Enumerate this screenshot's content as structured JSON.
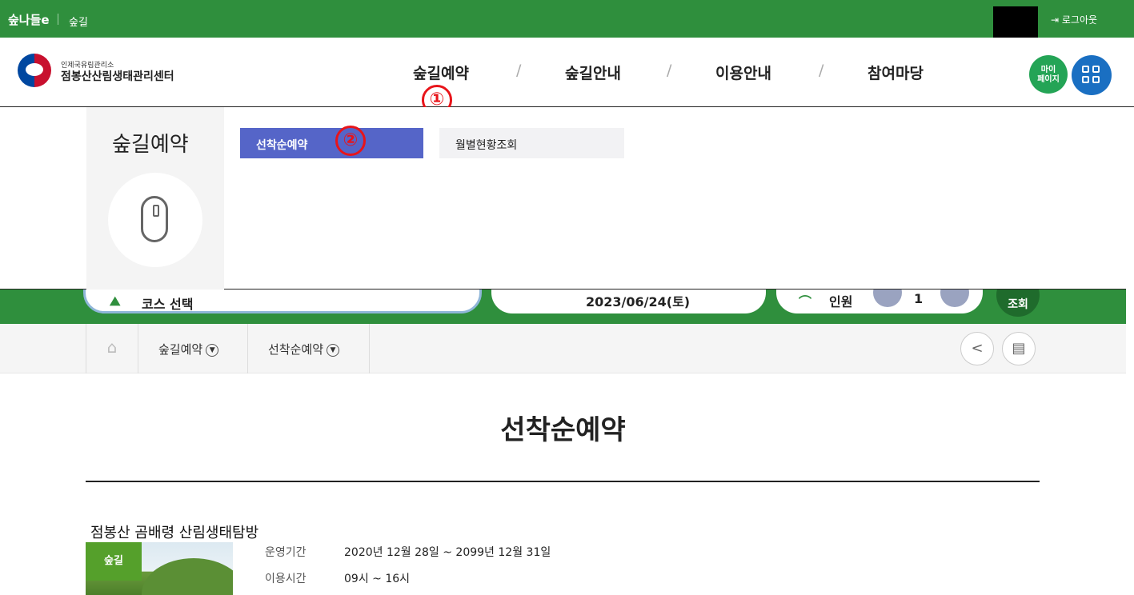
{
  "topbar": {
    "brand": "숲나들e",
    "sub": "숲길",
    "logout": "로그아웃"
  },
  "header": {
    "org_small": "인제국유림관리소",
    "org_main": "점봉산산림생태관리센터",
    "nav": [
      "숲길예약",
      "숲길안내",
      "이용안내",
      "참여마당"
    ],
    "slash": "/",
    "mypage": [
      "마이",
      "페이지"
    ],
    "annotation1": "①",
    "annotation2": "②"
  },
  "dropdown": {
    "title": "숲길예약",
    "items": [
      "선착순예약",
      "월별현황조회"
    ]
  },
  "searchbar": {
    "course": "코스 선택",
    "date": "2023/06/24(토)",
    "people_label": "인원",
    "people_count": "1",
    "search": "조회"
  },
  "breadcrumb": {
    "home": "⌂",
    "items": [
      "숲길예약",
      "선착순예약"
    ]
  },
  "main": {
    "title": "선착순예약",
    "course_name": "점봉산 곰배령 산림생태탐방",
    "tag": "숲길",
    "period_label": "운영기간",
    "period_value": "2020년 12월 28일 ~ 2099년 12월 31일",
    "time_label": "이용시간",
    "time_value": "09시 ~ 16시"
  },
  "colors": {
    "green": "#2f8f3d",
    "blue_active": "#5565c8",
    "annotation_red": "#e8141a"
  }
}
